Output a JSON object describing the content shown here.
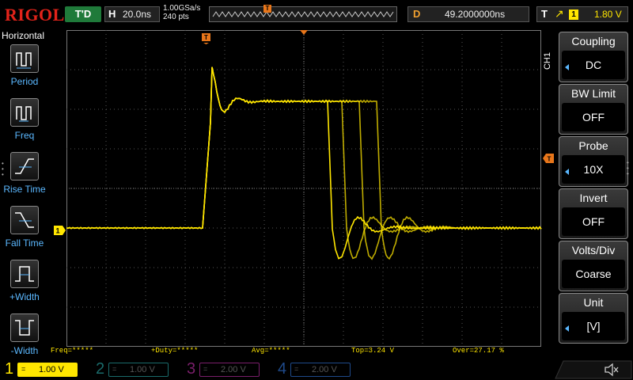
{
  "brand": "RIGOL",
  "run_status": "T'D",
  "horizontal": {
    "label": "H",
    "timebase": "20.0ns",
    "sample_rate": "1.00GSa/s",
    "points": "240 pts"
  },
  "delay": {
    "label": "D",
    "value": "49.2000000ns"
  },
  "trigger": {
    "label": "T",
    "slope": "↗",
    "source": "1",
    "level": "1.80 V"
  },
  "markers": {
    "trigger_position": "T",
    "channel1": "1"
  },
  "left_menu": {
    "title": "Horizontal",
    "items": [
      {
        "label": "Period",
        "icon": "period-icon"
      },
      {
        "label": "Freq",
        "icon": "freq-icon"
      },
      {
        "label": "Rise Time",
        "icon": "rise-time-icon"
      },
      {
        "label": "Fall Time",
        "icon": "fall-time-icon"
      },
      {
        "label": "+Width",
        "icon": "positive-width-icon"
      },
      {
        "label": "-Width",
        "icon": "negative-width-icon"
      }
    ]
  },
  "right_menu": {
    "channel": "CH1",
    "items": [
      {
        "title": "Coupling",
        "value": "DC"
      },
      {
        "title": "BW Limit",
        "value": "OFF"
      },
      {
        "title": "Probe",
        "value": "10X"
      },
      {
        "title": "Invert",
        "value": "OFF"
      },
      {
        "title": "Volts/Div",
        "value": "Coarse"
      },
      {
        "title": "Unit",
        "value": "[V]"
      }
    ]
  },
  "measurements": [
    {
      "text": "Freq=*****"
    },
    {
      "text": "+Duty=*****"
    },
    {
      "text": "Avg=*****"
    },
    {
      "text": "Top=3.24 V"
    },
    {
      "text": "Over=27.17 %"
    }
  ],
  "channels": [
    {
      "num": "1",
      "coupling": "=",
      "scale": "1.00 V",
      "color": "#ffe600",
      "active": true
    },
    {
      "num": "2",
      "coupling": "=",
      "scale": "1.00 V",
      "color": "#1a6b6b",
      "active": false
    },
    {
      "num": "3",
      "coupling": "=",
      "scale": "2.00 V",
      "color": "#7a1f6b",
      "active": false
    },
    {
      "num": "4",
      "coupling": "=",
      "scale": "2.00 V",
      "color": "#1f4a8a",
      "active": false
    }
  ],
  "colors": {
    "trace": "#ffe600",
    "trigger": "#e8761a",
    "grid": "#555555",
    "menu_label": "#5bb8ff"
  }
}
